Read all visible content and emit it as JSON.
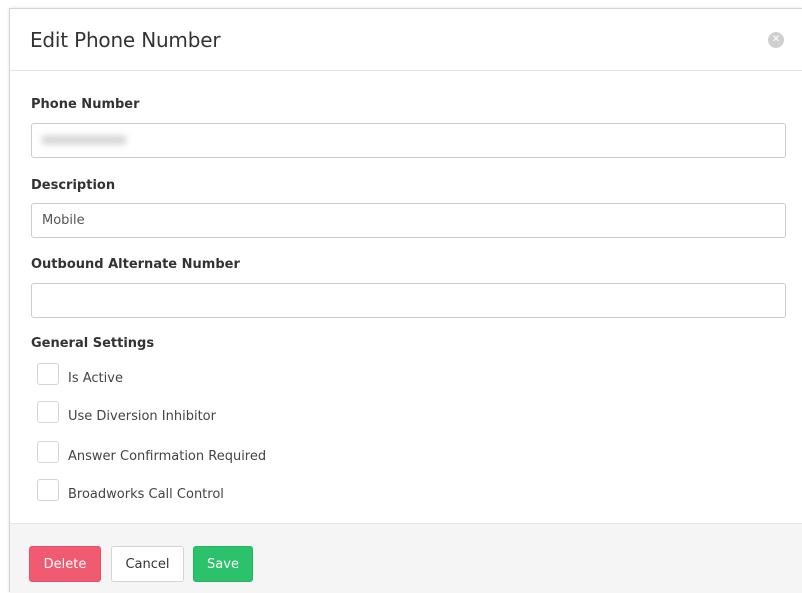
{
  "dialog": {
    "title": "Edit Phone Number",
    "close_icon": "close-icon"
  },
  "fields": {
    "phone_number": {
      "label": "Phone Number",
      "value": ""
    },
    "description": {
      "label": "Description",
      "value": "Mobile"
    },
    "outbound_alternate": {
      "label": "Outbound Alternate Number",
      "value": ""
    }
  },
  "general_settings": {
    "label": "General Settings",
    "options": [
      {
        "label": "Is Active",
        "checked": false
      },
      {
        "label": "Use Diversion Inhibitor",
        "checked": false
      },
      {
        "label": "Answer Confirmation Required",
        "checked": false
      },
      {
        "label": "Broadworks Call Control",
        "checked": false
      }
    ]
  },
  "footer": {
    "delete_label": "Delete",
    "cancel_label": "Cancel",
    "save_label": "Save"
  },
  "colors": {
    "delete": "#f05b72",
    "save": "#2bc26b",
    "footer_bg": "#f5f5f5"
  }
}
